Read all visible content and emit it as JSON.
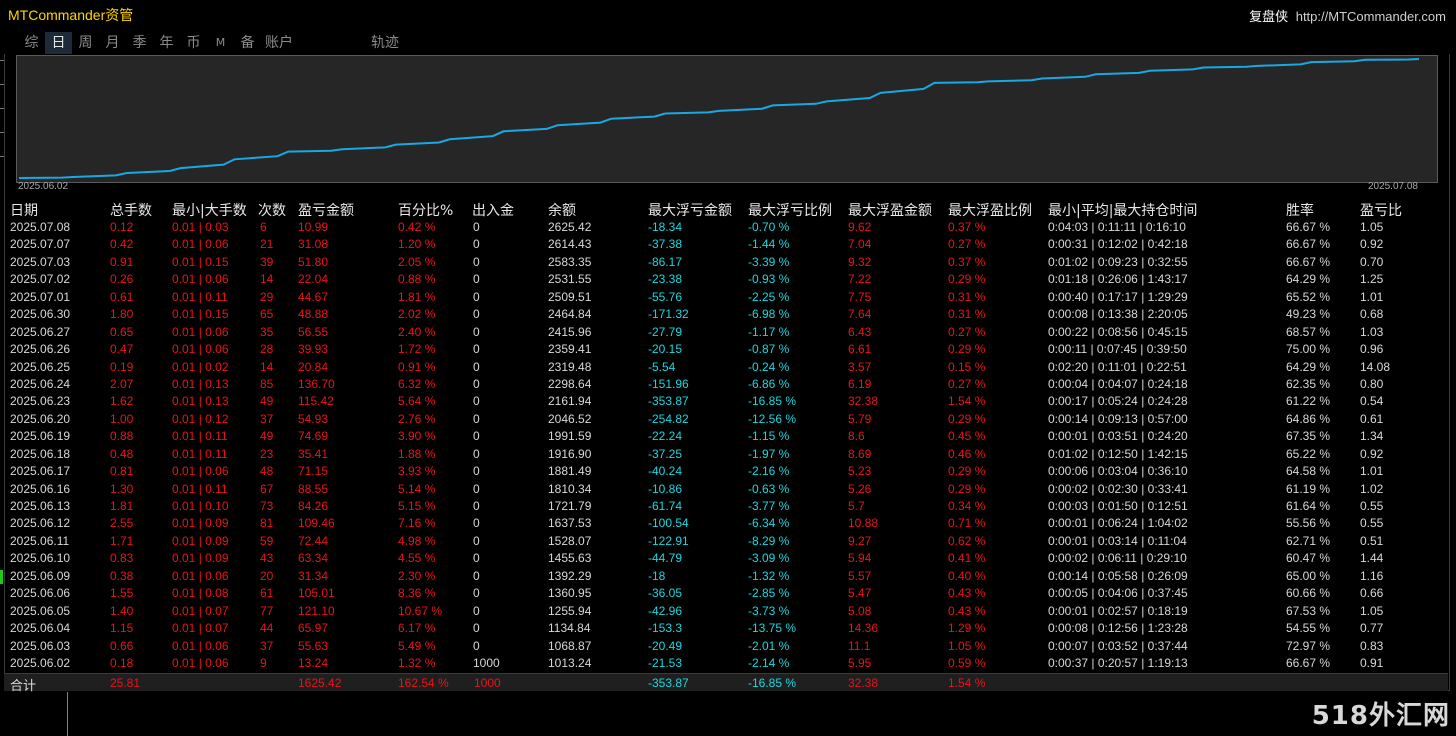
{
  "app": {
    "title": "MTCommander资管",
    "brand": "复盘侠",
    "url": "http://MTCommander.com"
  },
  "tabs": [
    {
      "label": "综",
      "active": false
    },
    {
      "label": "日",
      "active": true
    },
    {
      "label": "周",
      "active": false
    },
    {
      "label": "月",
      "active": false
    },
    {
      "label": "季",
      "active": false
    },
    {
      "label": "年",
      "active": false
    },
    {
      "label": "币",
      "active": false
    },
    {
      "label": "M",
      "active": false
    },
    {
      "label": "备",
      "active": false
    },
    {
      "label": "账户",
      "active": false
    },
    {
      "label": "轨迹",
      "active": false
    }
  ],
  "chart": {
    "start_label": "2025.06.02",
    "end_label": "2025.07.08",
    "line_color": "#1aa8e0",
    "background": "#262626"
  },
  "table": {
    "headers": [
      "日期",
      "总手数",
      "最小|大手数",
      "次数",
      "盈亏金额",
      "百分比%",
      "出入金",
      "余额",
      "最大浮亏金额",
      "最大浮亏比例",
      "最大浮盈金额",
      "最大浮盈比例",
      "最小|平均|最大持仓时间",
      "胜率",
      "盈亏比"
    ],
    "rows": [
      [
        "2025.07.08",
        "0.12",
        "0.01 | 0.03",
        "6",
        "10.99",
        "0.42 %",
        "0",
        "2625.42",
        "-18.34",
        "-0.70 %",
        "9.62",
        "0.37 %",
        "0:04:03 | 0:11:11 | 0:16:10",
        "66.67 %",
        "1.05"
      ],
      [
        "2025.07.07",
        "0.42",
        "0.01 | 0.06",
        "21",
        "31.08",
        "1.20 %",
        "0",
        "2614.43",
        "-37.38",
        "-1.44 %",
        "7.04",
        "0.27 %",
        "0:00:31 | 0:12:02 | 0:42:18",
        "66.67 %",
        "0.92"
      ],
      [
        "2025.07.03",
        "0.91",
        "0.01 | 0.15",
        "39",
        "51.80",
        "2.05 %",
        "0",
        "2583.35",
        "-86.17",
        "-3.39 %",
        "9.32",
        "0.37 %",
        "0:01:02 | 0:09:23 | 0:32:55",
        "66.67 %",
        "0.70"
      ],
      [
        "2025.07.02",
        "0.26",
        "0.01 | 0.06",
        "14",
        "22.04",
        "0.88 %",
        "0",
        "2531.55",
        "-23.38",
        "-0.93 %",
        "7.22",
        "0.29 %",
        "0:01:18 | 0:26:06 | 1:43:17",
        "64.29 %",
        "1.25"
      ],
      [
        "2025.07.01",
        "0.61",
        "0.01 | 0.11",
        "29",
        "44.67",
        "1.81 %",
        "0",
        "2509.51",
        "-55.76",
        "-2.25 %",
        "7.75",
        "0.31 %",
        "0:00:40 | 0:17:17 | 1:29:29",
        "65.52 %",
        "1.01"
      ],
      [
        "2025.06.30",
        "1.80",
        "0.01 | 0.15",
        "65",
        "48.88",
        "2.02 %",
        "0",
        "2464.84",
        "-171.32",
        "-6.98 %",
        "7.64",
        "0.31 %",
        "0:00:08 | 0:13:38 | 2:20:05",
        "49.23 %",
        "0.68"
      ],
      [
        "2025.06.27",
        "0.65",
        "0.01 | 0.06",
        "35",
        "56.55",
        "2.40 %",
        "0",
        "2415.96",
        "-27.79",
        "-1.17 %",
        "6.43",
        "0.27 %",
        "0:00:22 | 0:08:56 | 0:45:15",
        "68.57 %",
        "1.03"
      ],
      [
        "2025.06.26",
        "0.47",
        "0.01 | 0.06",
        "28",
        "39.93",
        "1.72 %",
        "0",
        "2359.41",
        "-20.15",
        "-0.87 %",
        "6.61",
        "0.29 %",
        "0:00:11 | 0:07:45 | 0:39:50",
        "75.00 %",
        "0.96"
      ],
      [
        "2025.06.25",
        "0.19",
        "0.01 | 0.02",
        "14",
        "20.84",
        "0.91 %",
        "0",
        "2319.48",
        "-5.54",
        "-0.24 %",
        "3.57",
        "0.15 %",
        "0:02:20 | 0:11:01 | 0:22:51",
        "64.29 %",
        "14.08"
      ],
      [
        "2025.06.24",
        "2.07",
        "0.01 | 0.13",
        "85",
        "136.70",
        "6.32 %",
        "0",
        "2298.64",
        "-151.96",
        "-6.86 %",
        "6.19",
        "0.27 %",
        "0:00:04 | 0:04:07 | 0:24:18",
        "62.35 %",
        "0.80"
      ],
      [
        "2025.06.23",
        "1.62",
        "0.01 | 0.13",
        "49",
        "115.42",
        "5.64 %",
        "0",
        "2161.94",
        "-353.87",
        "-16.85 %",
        "32.38",
        "1.54 %",
        "0:00:17 | 0:05:24 | 0:24:28",
        "61.22 %",
        "0.54"
      ],
      [
        "2025.06.20",
        "1.00",
        "0.01 | 0.12",
        "37",
        "54.93",
        "2.76 %",
        "0",
        "2046.52",
        "-254.82",
        "-12.56 %",
        "5.79",
        "0.29 %",
        "0:00:14 | 0:09:13 | 0:57:00",
        "64.86 %",
        "0.61"
      ],
      [
        "2025.06.19",
        "0.88",
        "0.01 | 0.11",
        "49",
        "74.69",
        "3.90 %",
        "0",
        "1991.59",
        "-22.24",
        "-1.15 %",
        "8.6",
        "0.45 %",
        "0:00:01 | 0:03:51 | 0:24:20",
        "67.35 %",
        "1.34"
      ],
      [
        "2025.06.18",
        "0.48",
        "0.01 | 0.11",
        "23",
        "35.41",
        "1.88 %",
        "0",
        "1916.90",
        "-37.25",
        "-1.97 %",
        "8.69",
        "0.46 %",
        "0:01:02 | 0:12:50 | 1:42:15",
        "65.22 %",
        "0.92"
      ],
      [
        "2025.06.17",
        "0.81",
        "0.01 | 0.06",
        "48",
        "71.15",
        "3.93 %",
        "0",
        "1881.49",
        "-40.24",
        "-2.16 %",
        "5.23",
        "0.29 %",
        "0:00:06 | 0:03:04 | 0:36:10",
        "64.58 %",
        "1.01"
      ],
      [
        "2025.06.16",
        "1.30",
        "0.01 | 0.11",
        "67",
        "88.55",
        "5.14 %",
        "0",
        "1810.34",
        "-10.86",
        "-0.63 %",
        "5.26",
        "0.29 %",
        "0:00:02 | 0:02:30 | 0:33:41",
        "61.19 %",
        "1.02"
      ],
      [
        "2025.06.13",
        "1.81",
        "0.01 | 0.10",
        "73",
        "84.26",
        "5.15 %",
        "0",
        "1721.79",
        "-61.74",
        "-3.77 %",
        "5.7",
        "0.34 %",
        "0:00:03 | 0:01:50 | 0:12:51",
        "61.64 %",
        "0.55"
      ],
      [
        "2025.06.12",
        "2.55",
        "0.01 | 0.09",
        "81",
        "109.46",
        "7.16 %",
        "0",
        "1637.53",
        "-100.54",
        "-6.34 %",
        "10.88",
        "0.71 %",
        "0:00:01 | 0:06:24 | 1:04:02",
        "55.56 %",
        "0.55"
      ],
      [
        "2025.06.11",
        "1.71",
        "0.01 | 0.09",
        "59",
        "72.44",
        "4.98 %",
        "0",
        "1528.07",
        "-122.91",
        "-8.29 %",
        "9.27",
        "0.62 %",
        "0:00:01 | 0:03:14 | 0:11:04",
        "62.71 %",
        "0.51"
      ],
      [
        "2025.06.10",
        "0.83",
        "0.01 | 0.09",
        "43",
        "63.34",
        "4.55 %",
        "0",
        "1455.63",
        "-44.79",
        "-3.09 %",
        "5.94",
        "0.41 %",
        "0:00:02 | 0:06:11 | 0:29:10",
        "60.47 %",
        "1.44"
      ],
      [
        "2025.06.09",
        "0.38",
        "0.01 | 0.06",
        "20",
        "31.34",
        "2.30 %",
        "0",
        "1392.29",
        "-18",
        "-1.32 %",
        "5.57",
        "0.40 %",
        "0:00:14 | 0:05:58 | 0:26:09",
        "65.00 %",
        "1.16"
      ],
      [
        "2025.06.06",
        "1.55",
        "0.01 | 0.08",
        "61",
        "105.01",
        "8.36 %",
        "0",
        "1360.95",
        "-36.05",
        "-2.85 %",
        "5.47",
        "0.43 %",
        "0:00:05 | 0:04:06 | 0:37:45",
        "60.66 %",
        "0.66"
      ],
      [
        "2025.06.05",
        "1.40",
        "0.01 | 0.07",
        "77",
        "121.10",
        "10.67 %",
        "0",
        "1255.94",
        "-42.96",
        "-3.73 %",
        "5.08",
        "0.43 %",
        "0:00:01 | 0:02:57 | 0:18:19",
        "67.53 %",
        "1.05"
      ],
      [
        "2025.06.04",
        "1.15",
        "0.01 | 0.07",
        "44",
        "65.97",
        "6.17 %",
        "0",
        "1134.84",
        "-153.3",
        "-13.75 %",
        "14.36",
        "1.29 %",
        "0:00:08 | 0:12:56 | 1:23:28",
        "54.55 %",
        "0.77"
      ],
      [
        "2025.06.03",
        "0.66",
        "0.01 | 0.06",
        "37",
        "55.63",
        "5.49 %",
        "0",
        "1068.87",
        "-20.49",
        "-2.01 %",
        "11.1",
        "1.05 %",
        "0:00:07 | 0:03:52 | 0:37:44",
        "72.97 %",
        "0.83"
      ],
      [
        "2025.06.02",
        "0.18",
        "0.01 | 0.06",
        "9",
        "13.24",
        "1.32 %",
        "1000",
        "1013.24",
        "-21.53",
        "-2.14 %",
        "5.95",
        "0.59 %",
        "0:00:37 | 0:20:57 | 1:19:13",
        "66.67 %",
        "0.91"
      ]
    ],
    "total": {
      "label": "合计",
      "lots": "25.81",
      "pnl": "1625.42",
      "pct": "162.54 %",
      "deposit": "1000",
      "max_float_loss": "-353.87",
      "max_float_loss_pct": "-16.85 %",
      "max_float_profit": "32.38",
      "max_float_profit_pct": "1.54 %"
    }
  },
  "colors": {
    "text": "#d8d8d8",
    "red": "#e8141c",
    "cyan": "#18d8e0",
    "title": "#ffd400"
  },
  "watermark": "518外汇网"
}
